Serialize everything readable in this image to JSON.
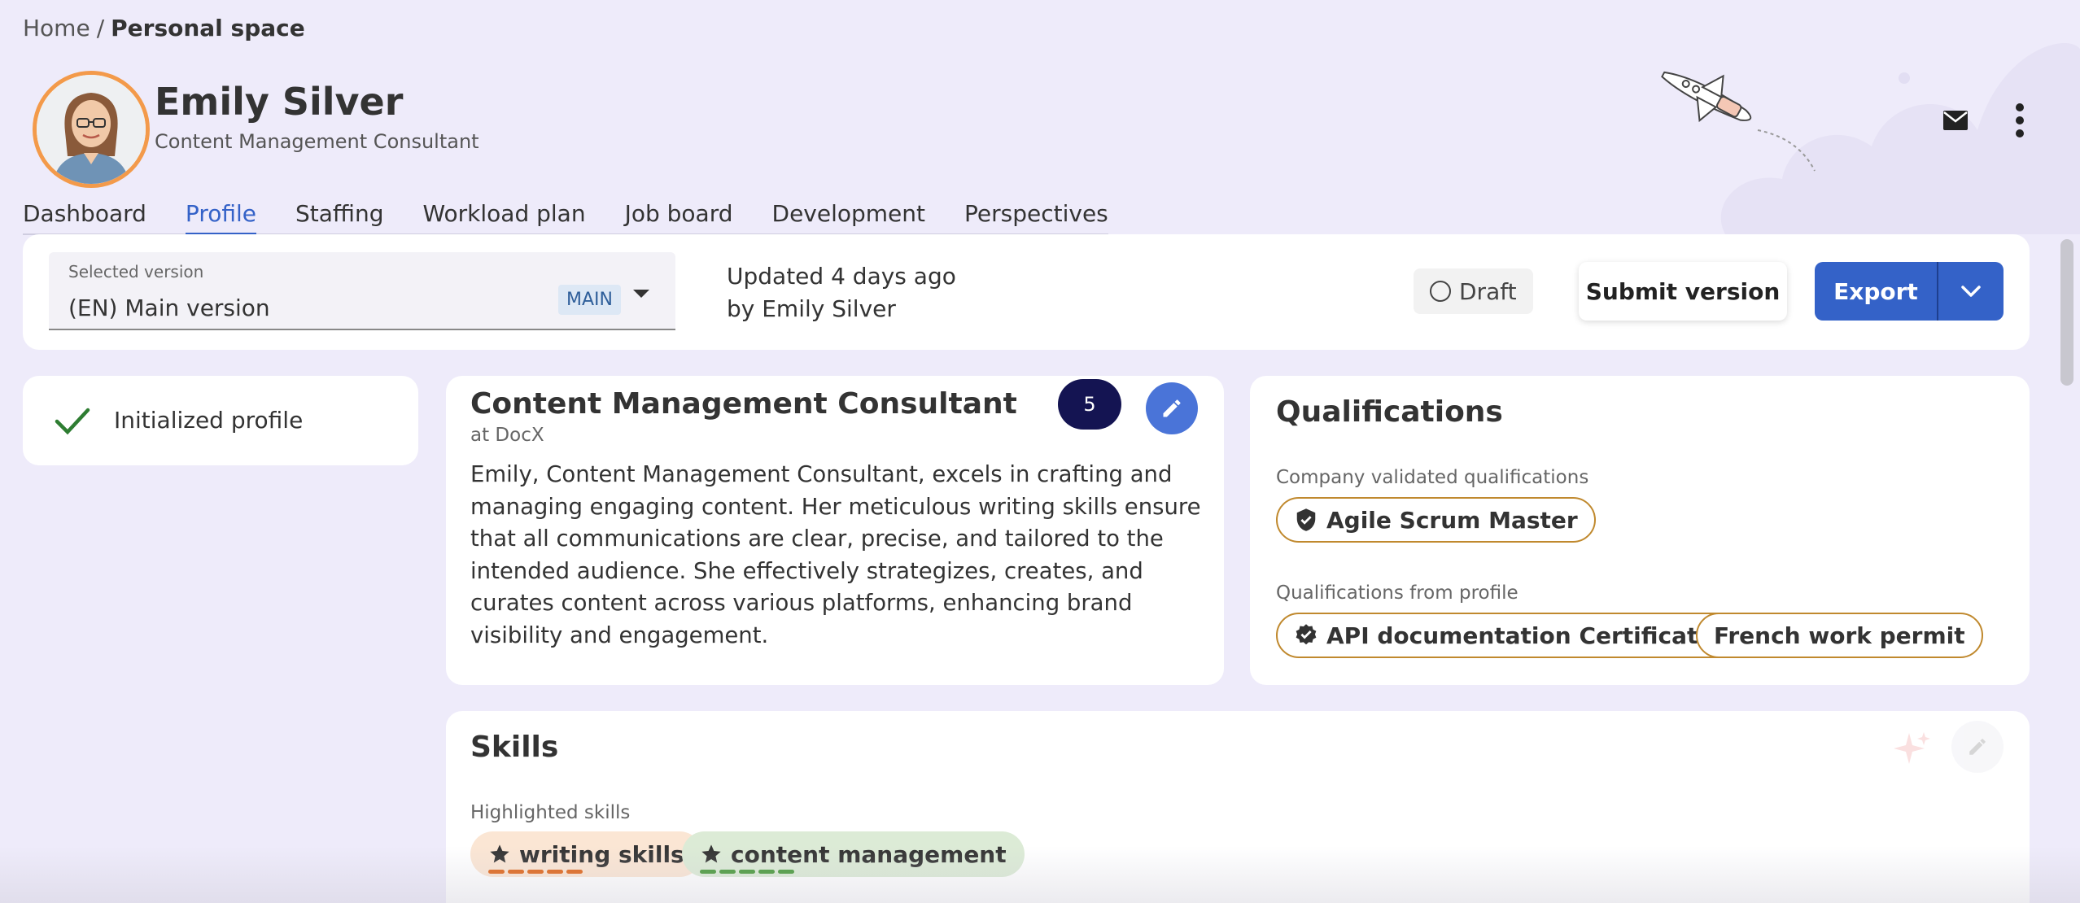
{
  "breadcrumb": {
    "home": "Home",
    "separator": "/",
    "current": "Personal space"
  },
  "user": {
    "name": "Emily Silver",
    "role": "Content Management Consultant"
  },
  "header_icons": {
    "mail": "mail-icon",
    "more": "more-vert-icon"
  },
  "tabs": [
    {
      "label": "Dashboard",
      "active": false
    },
    {
      "label": "Profile",
      "active": true
    },
    {
      "label": "Staffing",
      "active": false
    },
    {
      "label": "Workload plan",
      "active": false
    },
    {
      "label": "Job board",
      "active": false
    },
    {
      "label": "Development",
      "active": false
    },
    {
      "label": "Perspectives",
      "active": false
    }
  ],
  "version": {
    "label": "Selected version",
    "value": "(EN) Main version",
    "tag": "MAIN",
    "updated_line1": "Updated 4 days ago",
    "updated_line2": "by Emily Silver",
    "status": "Draft",
    "submit_label": "Submit version",
    "export_label": "Export"
  },
  "init_card": {
    "label": "Initialized profile"
  },
  "summary": {
    "title": "Content Management Consultant",
    "company": "at DocX",
    "count": "5",
    "text": "Emily, Content Management Consultant, excels in crafting and managing engaging content. Her meticulous writing skills ensure that all communications are clear, precise, and tailored to the intended audience. She effectively strategizes, creates, and curates content across various platforms, enhancing brand visibility and engagement."
  },
  "qualifications": {
    "title": "Qualifications",
    "validated_label": "Company validated qualifications",
    "validated": [
      "Agile Scrum Master"
    ],
    "profile_label": "Qualifications from profile",
    "profile": [
      "API documentation Certification",
      "French work permit"
    ]
  },
  "skills": {
    "title": "Skills",
    "highlighted_label": "Highlighted skills",
    "highlighted": [
      {
        "name": "writing skills",
        "bg": "#fbe6d4",
        "dash": "#e0661a"
      },
      {
        "name": "content management",
        "bg": "#dcebd6",
        "dash": "#4a9a3c"
      }
    ]
  },
  "colors": {
    "accent": "#3462c8",
    "background": "#eeebfa",
    "chip_border": "#c0892e",
    "badge": "#141452"
  }
}
